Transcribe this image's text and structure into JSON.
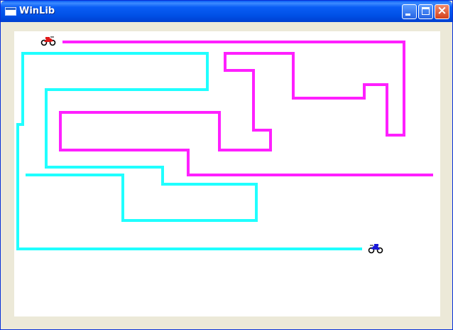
{
  "window": {
    "title": "WinLib"
  },
  "game": {
    "colors": {
      "red_trail": "#ff20ff",
      "blue_trail": "#20ffff",
      "red_bike": "#e01818",
      "blue_bike": "#1818d8"
    }
  }
}
